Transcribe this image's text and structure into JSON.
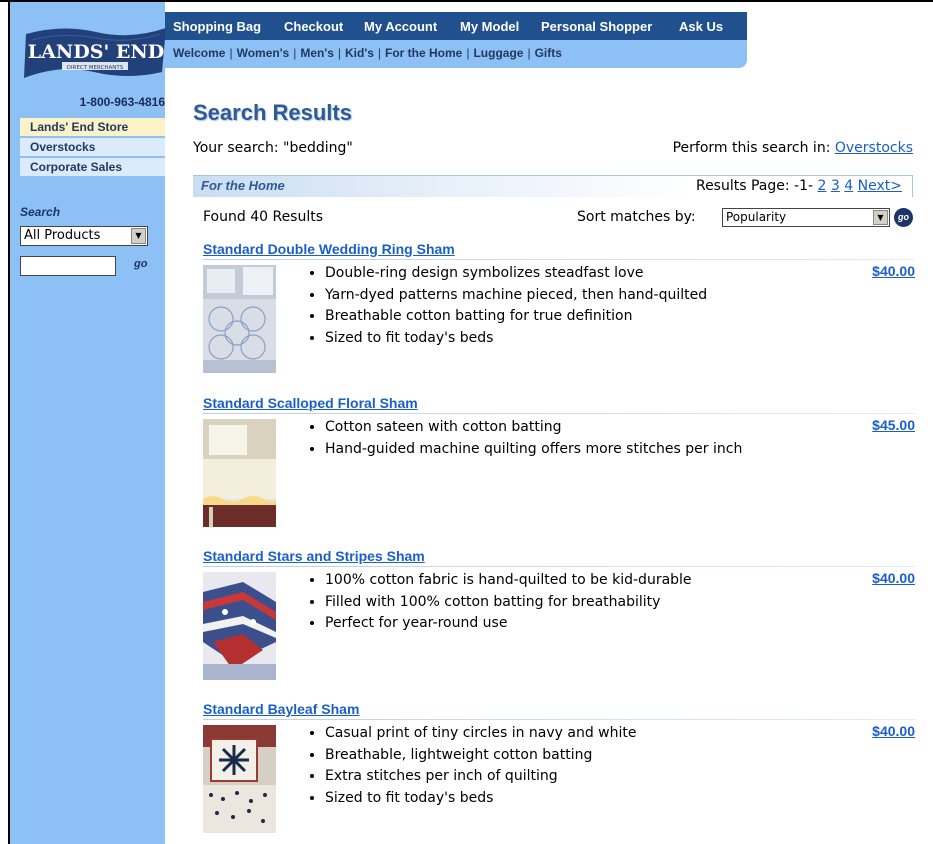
{
  "logo": {
    "text": "LANDS' END",
    "subtext": "DIRECT MERCHANTS"
  },
  "phone": "1-800-963-4816",
  "store_nav": [
    {
      "label": "Lands' End Store"
    },
    {
      "label": "Overstocks"
    },
    {
      "label": "Corporate Sales"
    }
  ],
  "side_search": {
    "label": "Search",
    "select_value": "All Products",
    "go": "go"
  },
  "top_nav": {
    "primary": [
      "Shopping Bag",
      "Checkout",
      "My Account",
      "My Model",
      "Personal Shopper",
      "Ask Us"
    ],
    "secondary": [
      "Welcome",
      "Women's",
      "Men's",
      "Kid's",
      "For the Home",
      "Luggage",
      "Gifts"
    ]
  },
  "page": {
    "title": "Search Results",
    "your_search": "Your search: \"bedding\"",
    "perform_label": "Perform this search in:",
    "perform_link": "Overstocks",
    "section": "For the Home",
    "results_page_label": "Results Page:",
    "current_page": "-1-",
    "pages": [
      "2",
      "3",
      "4"
    ],
    "next": "Next>",
    "found": "Found 40 Results",
    "sort_label": "Sort matches by:",
    "sort_value": "Popularity",
    "sort_go": "go"
  },
  "products": [
    {
      "title": "Standard Double Wedding Ring Sham",
      "price": "$40.00",
      "bullets": [
        "Double-ring design symbolizes steadfast love",
        "Yarn-dyed patterns machine pieced, then hand-quilted",
        "Breathable cotton batting for true definition",
        "Sized to fit today's beds"
      ]
    },
    {
      "title": "Standard Scalloped Floral Sham",
      "price": "$45.00",
      "bullets": [
        "Cotton sateen with cotton batting",
        "Hand-guided machine quilting offers more stitches per inch"
      ]
    },
    {
      "title": "Standard Stars and Stripes Sham",
      "price": "$40.00",
      "bullets": [
        "100% cotton fabric is hand-quilted to be kid-durable",
        "Filled with 100% cotton batting for breathability",
        "Perfect for year-round use"
      ]
    },
    {
      "title": "Standard Bayleaf Sham",
      "price": "$40.00",
      "bullets": [
        "Casual print of tiny circles in navy and white",
        "Breathable, lightweight cotton batting",
        "Extra stitches per inch of quilting",
        "Sized to fit today's beds"
      ]
    }
  ]
}
